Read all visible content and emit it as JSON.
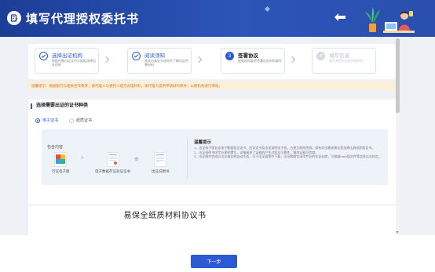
{
  "header": {
    "title": "填写代理授权委托书",
    "logo_icon": "edit-document-icon",
    "back_icon": "back-arrow-icon",
    "brand_color": "#1c3e97"
  },
  "steps": [
    {
      "name": "选择出证机构",
      "desc": "根据所需出证文书与报批选择出证机构",
      "status": "done"
    },
    {
      "name": "阅读须知",
      "desc": "阅读出具证书须知并了解出证所需材料",
      "status": "done"
    },
    {
      "number": "3",
      "name": "签署协议",
      "desc": "根据机构要求签署出证材料委托",
      "status": "active"
    },
    {
      "number": "4",
      "name": "填写信息",
      "desc": "填写并提交出证所需材料",
      "status": "inactive"
    }
  ],
  "notice": "温馨提示：根据银行与相关合作要求，请代理人与委托人提交办理材料，请代理人提供申请材料原件，以便机构进行审核。",
  "evidence": {
    "section_title": "选择需要出证的证书种类",
    "options": [
      {
        "label": "电子证书",
        "selected": true
      },
      {
        "label": "纸质证书",
        "selected": false
      }
    ],
    "includes_label": "包含内容",
    "items": [
      {
        "caption": "行证电子版"
      },
      {
        "caption": "电子数据存证验证证书"
      },
      {
        "caption": "出证说明书"
      }
    ],
    "tips_title": "温馨提示",
    "tips": [
      "1、出证电子版包含电子数据保全证书、验证证书及出证说明电子档，方便互联网传阅，如有司法需求建议您选择出具纸质版证书。",
      "2、出证说明书由专业律师撰写，详细描述了证据的产生过程及可靠性，增加证据可信度。",
      "3、出证操作完成后出证报告将自动生成，可于出证管理中下载，出证数据包采用专业的存证存储，可根据hash值文件等信息比对核实。"
    ]
  },
  "agreement": {
    "title": "易保全纸质材料协议书"
  },
  "footer": {
    "next_label": "下一步"
  }
}
